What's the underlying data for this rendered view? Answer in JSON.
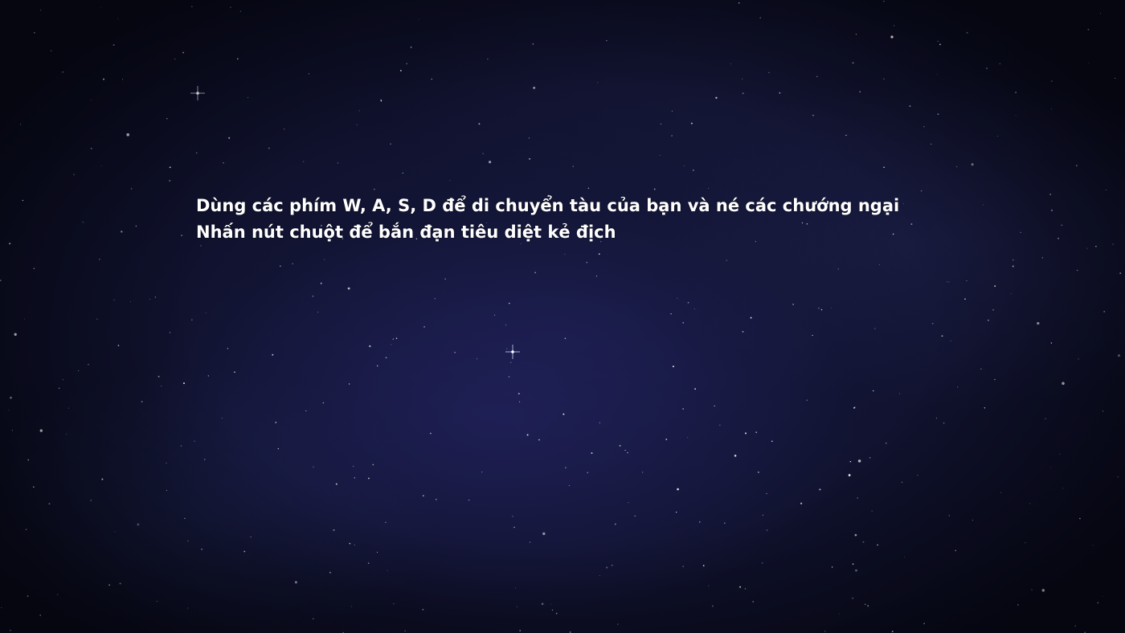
{
  "background": {
    "theme": "starfield-nebula",
    "base_color": "#0b0d22",
    "nebula_color": "#26266a",
    "star_color": "#ffffff"
  },
  "instructions": {
    "line1": "Dùng các phím W, A, S, D để di chuyển tàu của bạn và né các chướng ngại",
    "line2": "Nhấn nút chuột để bắn đạn tiêu diệt kẻ địch",
    "text_color": "#ffffff"
  }
}
